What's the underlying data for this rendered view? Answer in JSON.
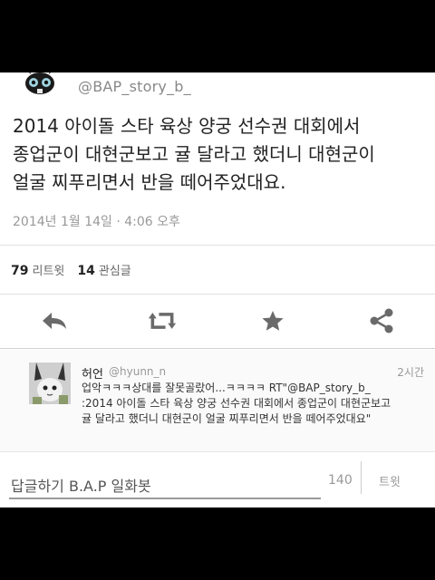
{
  "header": {
    "handle": "@BAP_story_b_"
  },
  "tweet": {
    "lines": [
      "2014 아이돌 스타 육상 양궁 선수권 대회에서",
      "종업군이 대현군보고 귤 달라고 했더니 대현군이",
      "얼굴 찌푸리면서 반을 떼어주었대요."
    ],
    "timestamp": "2014년 1월 14일 · 4:06 오후",
    "retweet_count": "79",
    "retweet_label": "리트윗",
    "favorite_count": "14",
    "favorite_label": "관심글"
  },
  "actions": {
    "icons": [
      "reply-icon",
      "retweet-icon",
      "favorite-star-icon",
      "share-icon"
    ],
    "color": "#6a6a6a"
  },
  "reply": {
    "name": "허언",
    "handle": "@hyunn_n",
    "time": "2시간",
    "lines": [
      "업악ㅋㅋㅋ상대를 잘못골랐어...ㅋㅋㅋㅋ RT\"@BAP_story_b_",
      ":2014 아이돌 스타 육상 양궁 선수권 대회에서 종업군이 대현군보고",
      "귤 달라고 했더니 대현군이 얼굴 찌푸리면서 반을 떼어주었대요\""
    ]
  },
  "composer": {
    "value": "답글하기 B.A.P 일화봇",
    "char_count": "140",
    "tweet_label": "트윗"
  }
}
